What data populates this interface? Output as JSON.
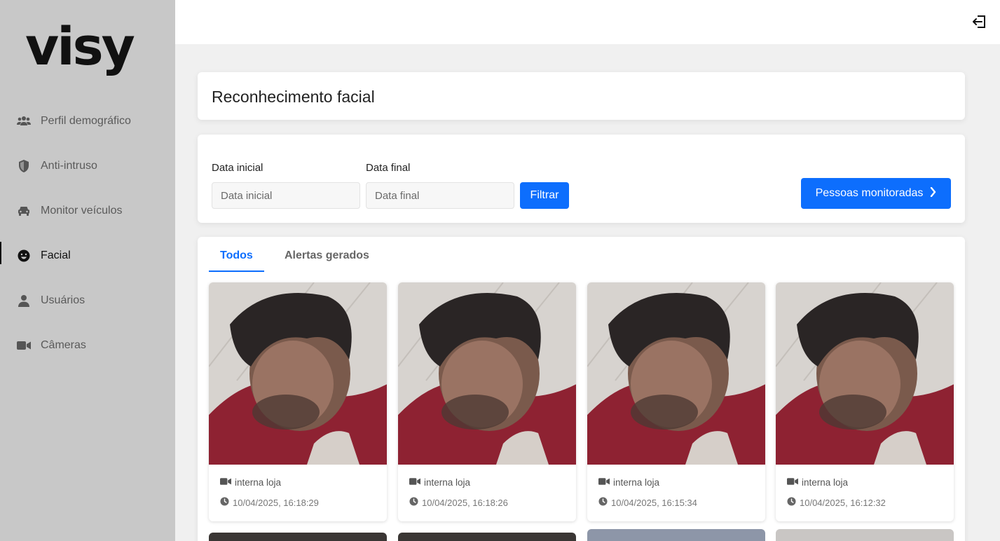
{
  "brand": {
    "logo_text": "visy"
  },
  "sidebar": {
    "items": [
      {
        "label": "Perfil demográfico",
        "icon": "users-icon"
      },
      {
        "label": "Anti-intruso",
        "icon": "shield-icon"
      },
      {
        "label": "Monitor veículos",
        "icon": "car-icon"
      },
      {
        "label": "Facial",
        "icon": "smile-icon",
        "active": true
      },
      {
        "label": "Usuários",
        "icon": "user-icon"
      },
      {
        "label": "Câmeras",
        "icon": "video-icon"
      }
    ]
  },
  "topbar": {
    "logout_icon": "logout-icon"
  },
  "page": {
    "title": "Reconhecimento facial"
  },
  "filter": {
    "start_label": "Data inicial",
    "start_placeholder": "Data inicial",
    "end_label": "Data final",
    "end_placeholder": "Data final",
    "filter_button": "Filtrar",
    "monitored_button": "Pessoas monitoradas"
  },
  "tabs": [
    {
      "label": "Todos",
      "active": true
    },
    {
      "label": "Alertas gerados",
      "active": false
    }
  ],
  "captures": [
    {
      "camera": "interna loja",
      "timestamp": "10/04/2025, 16:18:29"
    },
    {
      "camera": "interna loja",
      "timestamp": "10/04/2025, 16:18:26"
    },
    {
      "camera": "interna loja",
      "timestamp": "10/04/2025, 16:15:34"
    },
    {
      "camera": "interna loja",
      "timestamp": "10/04/2025, 16:12:32"
    }
  ],
  "colors": {
    "accent": "#0d6efd",
    "sidebar_bg": "#c8c8c8"
  }
}
